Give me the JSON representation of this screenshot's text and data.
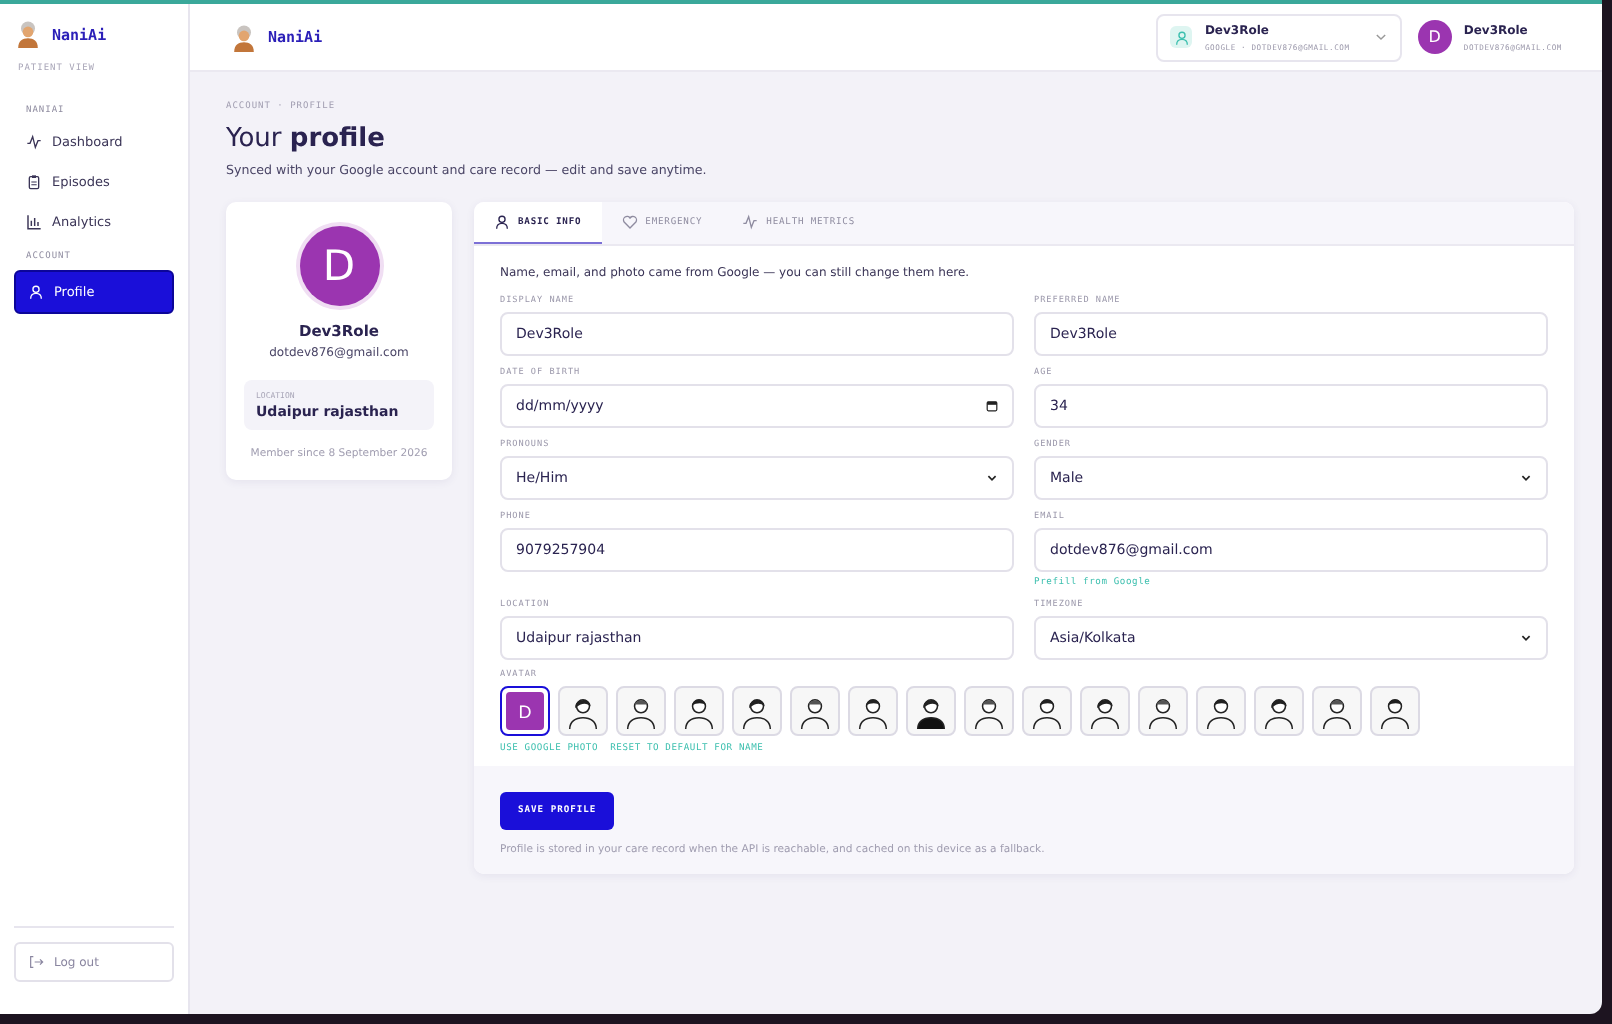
{
  "sidebar": {
    "brand": "NaniAi",
    "view_label": "PATIENT VIEW",
    "sections": [
      {
        "title": "NANIAI",
        "items": [
          {
            "label": "Dashboard",
            "kind": "pulse",
            "selected": false
          },
          {
            "label": "Episodes",
            "kind": "clipboard",
            "selected": false
          },
          {
            "label": "Analytics",
            "kind": "bars",
            "selected": false
          }
        ]
      },
      {
        "title": "ACCOUNT",
        "items": [
          {
            "label": "Profile",
            "kind": "person",
            "selected": true
          }
        ]
      }
    ],
    "logout": "Log out"
  },
  "header": {
    "brand": "NaniAi",
    "account": {
      "name": "Dev3Role",
      "detail": "GOOGLE · DOTDEV876@GMAIL.COM"
    },
    "user": {
      "initial": "D",
      "name": "Dev3Role",
      "email": "DOTDEV876@GMAIL.COM"
    }
  },
  "breadcrumb": "ACCOUNT · PROFILE",
  "title": "Your **profile**",
  "subtitle": "Synced with your Google account and care record — edit and save anytime.",
  "profile_card": {
    "initial": "D",
    "name": "Dev3Role",
    "email": "dotdev876@gmail.com",
    "location_label": "LOCATION",
    "location": "Udaipur rajasthan",
    "member_since": "Member since 8 September 2026"
  },
  "tabs": [
    {
      "label": "BASIC INFO",
      "kind": "person",
      "selected": true
    },
    {
      "label": "EMERGENCY",
      "kind": "heart",
      "selected": false
    },
    {
      "label": "HEALTH METRICS",
      "kind": "pulse",
      "selected": false
    }
  ],
  "intro": "Name, email, and photo came from Google — you can still change them here.",
  "fields": [
    {
      "label": "DISPLAY NAME",
      "kind": "text",
      "value": "Dev3Role"
    },
    {
      "label": "PREFERRED NAME",
      "kind": "text",
      "value": "Dev3Role"
    },
    {
      "label": "DATE OF BIRTH",
      "kind": "date",
      "placeholder": "dd/mm/yyyy"
    },
    {
      "label": "AGE",
      "kind": "text",
      "value": "34"
    },
    {
      "label": "PRONOUNS",
      "kind": "select",
      "value": "He/Him"
    },
    {
      "label": "GENDER",
      "kind": "select",
      "value": "Male"
    },
    {
      "label": "PHONE",
      "kind": "text",
      "value": "9079257904"
    },
    {
      "label": "EMAIL",
      "kind": "text",
      "value": "dotdev876@gmail.com",
      "helper": "Prefill from Google"
    },
    {
      "label": "LOCATION",
      "kind": "text",
      "value": "Udaipur rajasthan"
    },
    {
      "label": "TIMEZONE",
      "kind": "select",
      "value": "Asia/Kolkata"
    }
  ],
  "avatar": {
    "label": "AVATAR",
    "options": [
      {
        "kind": "initial",
        "initial": "D",
        "selected": true
      },
      {
        "kind": "illustration",
        "selected": false
      },
      {
        "kind": "illustration",
        "selected": false
      },
      {
        "kind": "illustration",
        "selected": false
      },
      {
        "kind": "illustration",
        "selected": false
      },
      {
        "kind": "illustration",
        "selected": false
      },
      {
        "kind": "illustration",
        "selected": false
      },
      {
        "kind": "illustration",
        "selected": false
      },
      {
        "kind": "illustration",
        "selected": false
      },
      {
        "kind": "illustration",
        "selected": false
      },
      {
        "kind": "illustration",
        "selected": false
      },
      {
        "kind": "illustration",
        "selected": false
      },
      {
        "kind": "illustration",
        "selected": false
      },
      {
        "kind": "illustration",
        "selected": false
      },
      {
        "kind": "illustration",
        "selected": false
      },
      {
        "kind": "illustration",
        "selected": false
      }
    ],
    "links": [
      "USE GOOGLE PHOTO",
      "RESET TO DEFAULT FOR NAME"
    ]
  },
  "save_button": "SAVE PROFILE",
  "footnote": "Profile is stored in your care record when the API is reachable, and cached on this device as a fallback."
}
